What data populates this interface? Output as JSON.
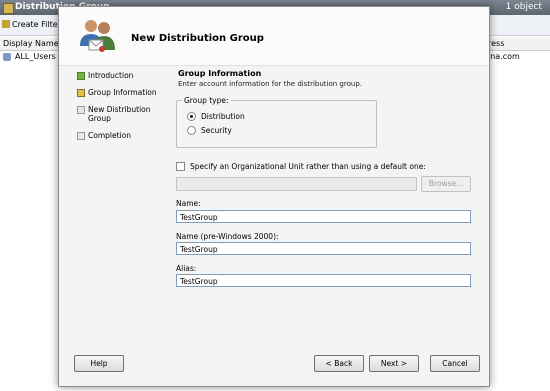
{
  "console": {
    "title": "Distribution Group ...",
    "object_count": "1 object",
    "toolbar_create_filter": "Create Filter",
    "columns": [
      "Display Name",
      "ress"
    ],
    "row": {
      "name": "ALL_Users",
      "address": "ina.com"
    }
  },
  "dialog": {
    "title": "New Distribution Group",
    "steps": [
      {
        "label": "Introduction",
        "state": "done"
      },
      {
        "label": "Group Information",
        "state": "current"
      },
      {
        "label": "New Distribution Group",
        "state": "pending"
      },
      {
        "label": "Completion",
        "state": "pending"
      }
    ],
    "section_title": "Group Information",
    "section_desc": "Enter account information for the distribution group.",
    "group_type": {
      "legend": "Group type:",
      "options": [
        {
          "label": "Distribution",
          "selected": true
        },
        {
          "label": "Security",
          "selected": false
        }
      ]
    },
    "ou_checkbox_label": "Specify an Organizational Unit rather than using a default one:",
    "ou_checked": false,
    "ou_path_value": "",
    "browse_label": "Browse...",
    "fields": [
      {
        "label": "Name:",
        "value": "TestGroup"
      },
      {
        "label": "Name (pre-Windows 2000):",
        "value": "TestGroup"
      },
      {
        "label": "Alias:",
        "value": "TestGroup"
      }
    ],
    "buttons": {
      "help": "Help",
      "back": "< Back",
      "next": "Next >",
      "cancel": "Cancel"
    }
  }
}
